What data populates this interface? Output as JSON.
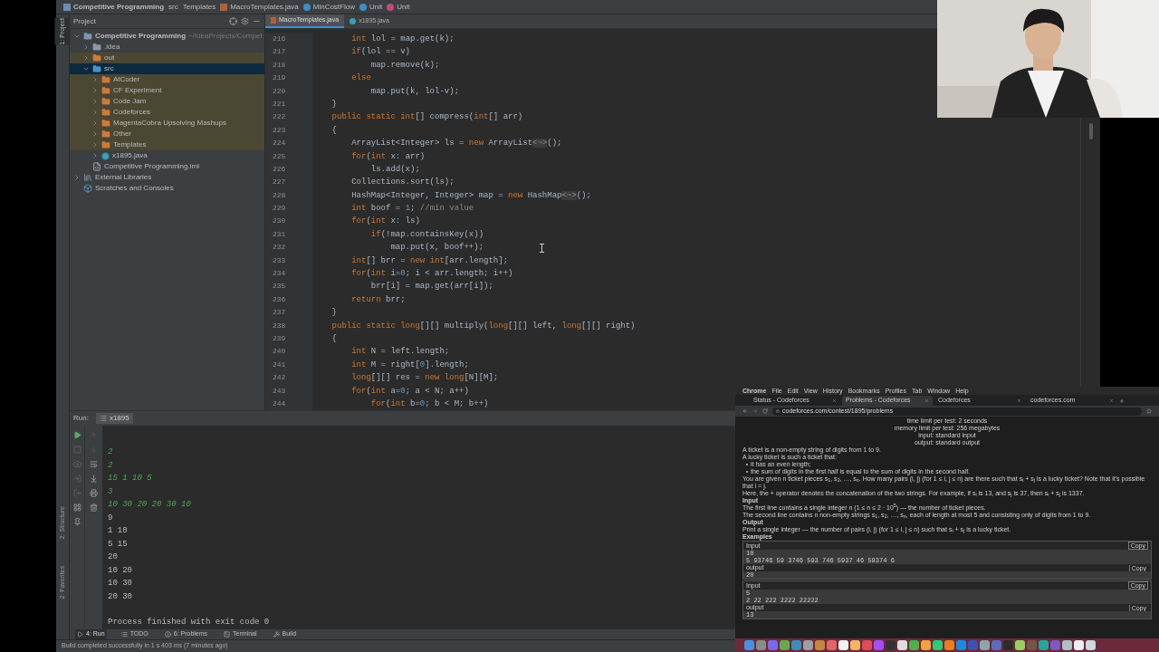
{
  "breadcrumbs": [
    {
      "label": "Competitive Programming",
      "kind": "project"
    },
    {
      "label": "src",
      "kind": "folder"
    },
    {
      "label": "Templates",
      "kind": "folder"
    },
    {
      "label": "MacroTemplates.java",
      "kind": "java"
    },
    {
      "label": "MinCostFlow",
      "kind": "class"
    },
    {
      "label": "Unit",
      "kind": "class"
    },
    {
      "label": "Unit",
      "kind": "method"
    }
  ],
  "tool_strip": {
    "top": [
      "1: Project"
    ],
    "bottom": [
      "2: Structure",
      "2: Favorites"
    ]
  },
  "project": {
    "title": "Project",
    "tree": [
      {
        "label": "Competitive Programming",
        "path": "~/IdeaProjects/Compet",
        "kind": "module",
        "expanded": true,
        "selected": false,
        "marked": false,
        "children": [
          {
            "label": ".idea",
            "kind": "folder",
            "color": "#8a9aab",
            "expanded": false,
            "selected": false,
            "marked": false
          },
          {
            "label": "out",
            "kind": "folder",
            "color": "#d07a3a",
            "expanded": false,
            "selected": false,
            "marked": true
          },
          {
            "label": "src",
            "kind": "folder",
            "color": "#4f8fc8",
            "expanded": true,
            "selected": true,
            "marked": false,
            "children": [
              {
                "label": "AtCoder",
                "kind": "folder",
                "color": "#d07a3a",
                "expanded": false,
                "selected": false,
                "marked": true
              },
              {
                "label": "CF Experiment",
                "kind": "folder",
                "color": "#d07a3a",
                "expanded": false,
                "selected": false,
                "marked": true
              },
              {
                "label": "Code Jam",
                "kind": "folder",
                "color": "#d07a3a",
                "expanded": false,
                "selected": false,
                "marked": true
              },
              {
                "label": "Codeforces",
                "kind": "folder",
                "color": "#d07a3a",
                "expanded": false,
                "selected": false,
                "marked": true
              },
              {
                "label": "MagentaCobra Upsolving Mashups",
                "kind": "folder",
                "color": "#d07a3a",
                "expanded": false,
                "selected": false,
                "marked": true
              },
              {
                "label": "Other",
                "kind": "folder",
                "color": "#d07a3a",
                "expanded": false,
                "selected": false,
                "marked": true
              },
              {
                "label": "Templates",
                "kind": "folder",
                "color": "#d07a3a",
                "expanded": false,
                "selected": false,
                "marked": true
              },
              {
                "label": "x1895.java",
                "kind": "java",
                "expanded": false,
                "selected": false,
                "marked": false
              }
            ]
          },
          {
            "label": "Competitive Programming.iml",
            "kind": "iml",
            "selected": false,
            "marked": false
          }
        ]
      },
      {
        "label": "External Libraries",
        "kind": "library",
        "expanded": false,
        "selected": false,
        "marked": false
      },
      {
        "label": "Scratches and Consoles",
        "kind": "scratch",
        "selected": false,
        "marked": false
      }
    ]
  },
  "editor": {
    "tabs": [
      {
        "label": "MacroTemplates.java",
        "kind": "java-file",
        "selected": true
      },
      {
        "label": "x1895.java",
        "kind": "class-file",
        "selected": false
      }
    ],
    "lines": [
      {
        "n": "216",
        "segs": [
          {
            "kind": "keyword",
            "text": "        int"
          },
          {
            "kind": "plain",
            "text": " lol = map.get(k);"
          }
        ]
      },
      {
        "n": "217",
        "segs": [
          {
            "kind": "keyword",
            "text": "        if"
          },
          {
            "kind": "plain",
            "text": "(lol == v)"
          }
        ]
      },
      {
        "n": "218",
        "segs": [
          {
            "kind": "plain",
            "text": "            map.remove(k);"
          }
        ]
      },
      {
        "n": "219",
        "segs": [
          {
            "kind": "keyword",
            "text": "        else"
          }
        ]
      },
      {
        "n": "220",
        "segs": [
          {
            "kind": "plain",
            "text": "            map.put(k, lol-v);"
          }
        ]
      },
      {
        "n": "221",
        "segs": [
          {
            "kind": "plain",
            "text": "    }"
          }
        ]
      },
      {
        "n": "222",
        "segs": [
          {
            "kind": "keyword",
            "text": "    public static int"
          },
          {
            "kind": "plain",
            "text": "[] compress("
          },
          {
            "kind": "keyword",
            "text": "int"
          },
          {
            "kind": "plain",
            "text": "[] arr)"
          }
        ]
      },
      {
        "n": "223",
        "segs": [
          {
            "kind": "plain",
            "text": "    {"
          }
        ]
      },
      {
        "n": "224",
        "segs": [
          {
            "kind": "plain",
            "text": "        ArrayList<Integer> ls = "
          },
          {
            "kind": "keyword",
            "text": "new"
          },
          {
            "kind": "plain",
            "text": " ArrayList"
          },
          {
            "kind": "fold",
            "text": "<~>"
          },
          {
            "kind": "plain",
            "text": "();"
          }
        ]
      },
      {
        "n": "225",
        "segs": [
          {
            "kind": "keyword",
            "text": "        for"
          },
          {
            "kind": "plain",
            "text": "("
          },
          {
            "kind": "keyword",
            "text": "int"
          },
          {
            "kind": "plain",
            "text": " x: arr)"
          }
        ]
      },
      {
        "n": "226",
        "segs": [
          {
            "kind": "plain",
            "text": "            ls.add(x);"
          }
        ]
      },
      {
        "n": "227",
        "segs": [
          {
            "kind": "plain",
            "text": "        Collections.sort(ls);"
          }
        ]
      },
      {
        "n": "228",
        "segs": [
          {
            "kind": "plain",
            "text": "        HashMap<Integer, Integer> map = "
          },
          {
            "kind": "keyword",
            "text": "new"
          },
          {
            "kind": "plain",
            "text": " HashMap"
          },
          {
            "kind": "fold",
            "text": "<~>"
          },
          {
            "kind": "plain",
            "text": "();"
          }
        ]
      },
      {
        "n": "229",
        "segs": [
          {
            "kind": "keyword",
            "text": "        int"
          },
          {
            "kind": "plain",
            "text": " boof = "
          },
          {
            "kind": "number",
            "text": "1"
          },
          {
            "kind": "plain",
            "text": "; "
          },
          {
            "kind": "comment",
            "text": "//min value"
          }
        ]
      },
      {
        "n": "230",
        "segs": [
          {
            "kind": "keyword",
            "text": "        for"
          },
          {
            "kind": "plain",
            "text": "("
          },
          {
            "kind": "keyword",
            "text": "int"
          },
          {
            "kind": "plain",
            "text": " x: ls)"
          }
        ]
      },
      {
        "n": "231",
        "segs": [
          {
            "kind": "keyword",
            "text": "            if"
          },
          {
            "kind": "plain",
            "text": "(!map.containsKey(x))"
          }
        ]
      },
      {
        "n": "232",
        "segs": [
          {
            "kind": "plain",
            "text": "                map.put(x, boof++);"
          }
        ]
      },
      {
        "n": "233",
        "segs": [
          {
            "kind": "keyword",
            "text": "        int"
          },
          {
            "kind": "plain",
            "text": "[] brr = "
          },
          {
            "kind": "keyword",
            "text": "new int"
          },
          {
            "kind": "plain",
            "text": "[arr.length];"
          }
        ]
      },
      {
        "n": "234",
        "segs": [
          {
            "kind": "keyword",
            "text": "        for"
          },
          {
            "kind": "plain",
            "text": "("
          },
          {
            "kind": "keyword",
            "text": "int"
          },
          {
            "kind": "plain",
            "text": " i="
          },
          {
            "kind": "number",
            "text": "0"
          },
          {
            "kind": "plain",
            "text": "; i < arr.length; i++)"
          }
        ]
      },
      {
        "n": "235",
        "segs": [
          {
            "kind": "plain",
            "text": "            brr[i] = map.get(arr[i]);"
          }
        ]
      },
      {
        "n": "236",
        "segs": [
          {
            "kind": "keyword",
            "text": "        return"
          },
          {
            "kind": "plain",
            "text": " brr;"
          }
        ]
      },
      {
        "n": "237",
        "segs": [
          {
            "kind": "plain",
            "text": "    }"
          }
        ]
      },
      {
        "n": "238",
        "segs": [
          {
            "kind": "keyword",
            "text": "    public static long"
          },
          {
            "kind": "plain",
            "text": "[][] multiply("
          },
          {
            "kind": "keyword",
            "text": "long"
          },
          {
            "kind": "plain",
            "text": "[][] left, "
          },
          {
            "kind": "keyword",
            "text": "long"
          },
          {
            "kind": "plain",
            "text": "[][] right)"
          }
        ]
      },
      {
        "n": "239",
        "segs": [
          {
            "kind": "plain",
            "text": "    {"
          }
        ]
      },
      {
        "n": "240",
        "segs": [
          {
            "kind": "keyword",
            "text": "        int"
          },
          {
            "kind": "plain",
            "text": " N = left.length;"
          }
        ]
      },
      {
        "n": "241",
        "segs": [
          {
            "kind": "keyword",
            "text": "        int"
          },
          {
            "kind": "plain",
            "text": " M = right["
          },
          {
            "kind": "number",
            "text": "0"
          },
          {
            "kind": "plain",
            "text": "].length;"
          }
        ]
      },
      {
        "n": "242",
        "segs": [
          {
            "kind": "keyword",
            "text": "        long"
          },
          {
            "kind": "plain",
            "text": "[][] res = "
          },
          {
            "kind": "keyword",
            "text": "new long"
          },
          {
            "kind": "plain",
            "text": "[N][M];"
          }
        ]
      },
      {
        "n": "243",
        "segs": [
          {
            "kind": "keyword",
            "text": "        for"
          },
          {
            "kind": "plain",
            "text": "("
          },
          {
            "kind": "keyword",
            "text": "int"
          },
          {
            "kind": "plain",
            "text": " a="
          },
          {
            "kind": "number",
            "text": "0"
          },
          {
            "kind": "plain",
            "text": "; a < N; a++)"
          }
        ]
      },
      {
        "n": "244",
        "segs": [
          {
            "kind": "keyword",
            "text": "            for"
          },
          {
            "kind": "plain",
            "text": "("
          },
          {
            "kind": "keyword",
            "text": "int"
          },
          {
            "kind": "plain",
            "text": " b="
          },
          {
            "kind": "number",
            "text": "0"
          },
          {
            "kind": "plain",
            "text": "; b < M; b++)"
          }
        ]
      }
    ]
  },
  "run": {
    "label": "Run:",
    "tab": "x1895",
    "lines": [
      {
        "kind": "input",
        "text": "2"
      },
      {
        "kind": "input",
        "text": "2"
      },
      {
        "kind": "input",
        "text": "15 1 10 5"
      },
      {
        "kind": "input",
        "text": "3"
      },
      {
        "kind": "input",
        "text": "10 30 20 20 30 10"
      },
      {
        "kind": "output",
        "text": "9"
      },
      {
        "kind": "output",
        "text": "1 10"
      },
      {
        "kind": "output",
        "text": "5 15"
      },
      {
        "kind": "output",
        "text": "20"
      },
      {
        "kind": "output",
        "text": "10 20"
      },
      {
        "kind": "output",
        "text": "10 30"
      },
      {
        "kind": "output",
        "text": "20 30"
      }
    ],
    "exit": "Process finished with exit code 0"
  },
  "tool_tabs": [
    {
      "label": "4: Run",
      "kind": "run",
      "selected": true
    },
    {
      "label": "TODO",
      "kind": "todo",
      "selected": false
    },
    {
      "label": "6: Problems",
      "kind": "problems",
      "selected": false
    },
    {
      "label": "Terminal",
      "kind": "terminal",
      "selected": false
    },
    {
      "label": "Build",
      "kind": "build",
      "selected": false
    }
  ],
  "status": "Build completed successfully in 1 s 403 ms (7 minutes ago)",
  "browser": {
    "menu": [
      "Chrome",
      "File",
      "Edit",
      "View",
      "History",
      "Bookmarks",
      "Profiles",
      "Tab",
      "Window",
      "Help"
    ],
    "tabs": [
      {
        "label": "Status - Codeforces",
        "selected": false
      },
      {
        "label": "Problems - Codeforces",
        "selected": true
      },
      {
        "label": "Codeforces",
        "selected": false
      },
      {
        "label": "codeforces.com",
        "selected": false
      }
    ],
    "url": "codeforces.com/contest/1895/problems",
    "statement": [
      {
        "kind": "meta",
        "text": "time limit per test: 2 seconds"
      },
      {
        "kind": "meta",
        "text": "memory limit per test: 256 megabytes"
      },
      {
        "kind": "meta",
        "text": "input: standard input"
      },
      {
        "kind": "meta",
        "text": "output: standard output"
      },
      {
        "kind": "para",
        "text": "A ticket is a non-empty string of digits from 1 to 9."
      },
      {
        "kind": "para",
        "text": "A lucky ticket is such a ticket that:"
      },
      {
        "kind": "bullet",
        "text": "it has an even length;"
      },
      {
        "kind": "bullet",
        "text": "the sum of digits in the first half is equal to the sum of digits in the second half."
      },
      {
        "kind": "para",
        "text": "You are given n ticket pieces s$_{1}$, s$_{2}$, …, s$_{n}$. How many pairs (i, j) (for 1 ≤ i, j ≤ n) are there such that s$_{i}$ + s$_{j}$ is a lucky ticket? Note that it's possible that i = j."
      },
      {
        "kind": "para",
        "text": "Here, the + operator denotes the concatenation of the two strings. For example, if s$_{i}$ is 13, and s$_{j}$ is 37, then s$_{i}$ + s$_{j}$ is 1337."
      },
      {
        "kind": "heading",
        "text": "Input"
      },
      {
        "kind": "line",
        "text": "The first line contains a single integer n (1 ≤ n ≤ 2 · 10$^{5}$) — the number of ticket pieces."
      },
      {
        "kind": "para",
        "text": "The second line contains n non-empty strings s$_{1}$, s$_{2}$, …, s$_{n}$, each of length at most 5 and consisting only of digits from 1 to 9."
      },
      {
        "kind": "heading",
        "text": "Output"
      },
      {
        "kind": "line",
        "text": "Print a single integer — the number of pairs (i, j) (for 1 ≤ i, j ≤ n) such that s$_{i}$ + s$_{j}$ is a lucky ticket."
      },
      {
        "kind": "heading",
        "text": "Examples"
      }
    ],
    "examples": [
      {
        "input_label": "Input",
        "copy": "Copy",
        "input": [
          "10",
          "5 93746 59 3746 593 746 5937 46 59374 6"
        ],
        "output_label": "output",
        "output_copy": "Copy",
        "output": [
          "20"
        ]
      },
      {
        "input_label": "Input",
        "copy": "Copy",
        "input": [
          "5",
          "2 22 222 2222 22222"
        ],
        "output_label": "output",
        "output_copy": "Copy",
        "output": [
          "13"
        ]
      }
    ]
  }
}
